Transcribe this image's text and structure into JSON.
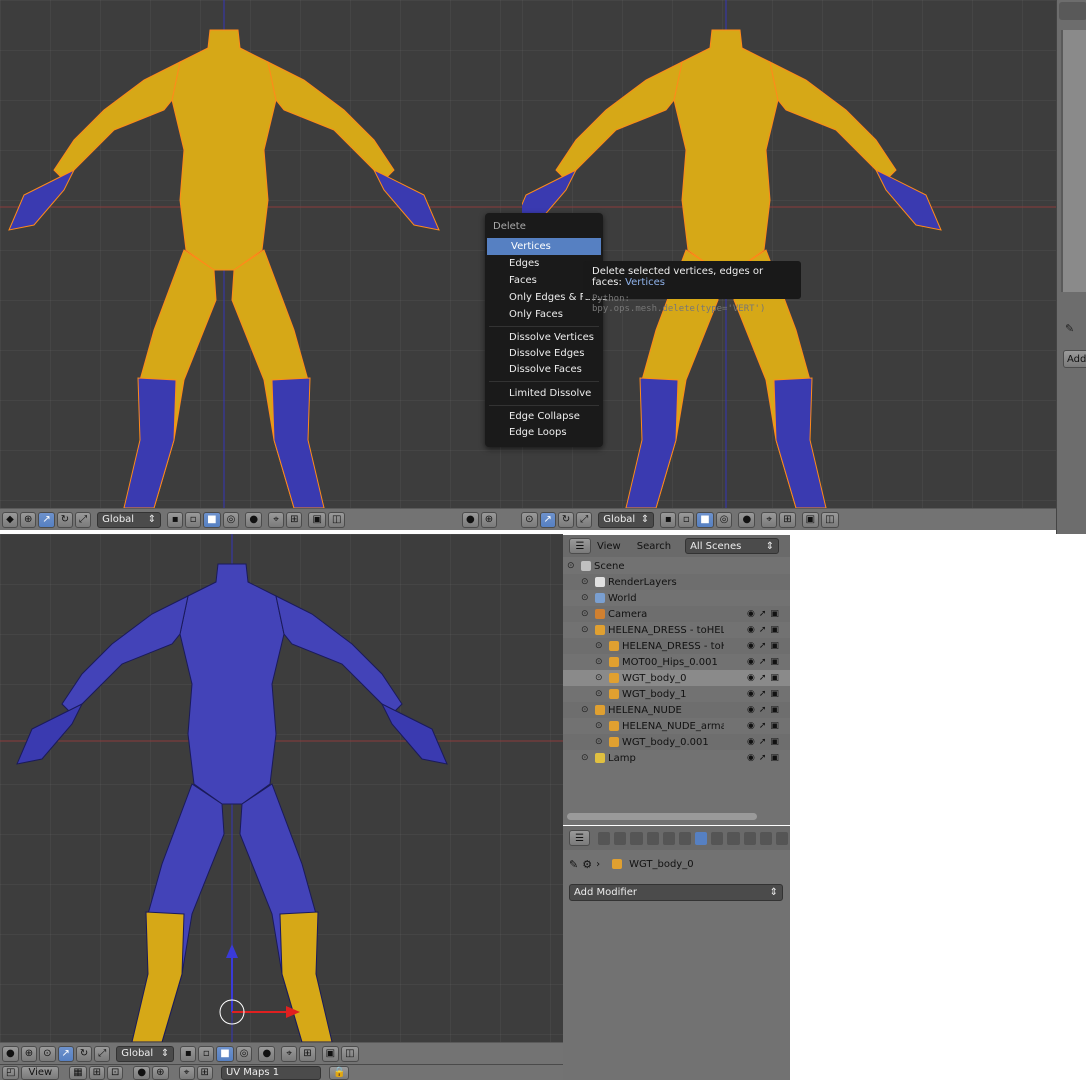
{
  "viewport_top_left": {
    "header": {
      "transform_orientation": "Global"
    }
  },
  "viewport_top_right": {
    "header": {
      "transform_orientation": "Global"
    }
  },
  "viewport_bottom": {
    "header": {
      "transform_orientation": "Global"
    }
  },
  "delete_menu": {
    "title": "Delete",
    "items": [
      "Vertices",
      "Edges",
      "Faces",
      "Only Edges & Faces",
      "Only Faces",
      "Dissolve Vertices",
      "Dissolve Edges",
      "Dissolve Faces",
      "Limited Dissolve",
      "Edge Collapse",
      "Edge Loops"
    ],
    "active": "Vertices"
  },
  "tooltip": {
    "description": "Delete selected vertices, edges or faces:",
    "value": "Vertices",
    "python": "Python: bpy.ops.mesh.delete(type='VERT')"
  },
  "outliner": {
    "menu_view": "View",
    "menu_search": "Search",
    "display_mode": "All Scenes",
    "rows": [
      {
        "label": "Scene",
        "indent": 0,
        "icon": "scene-icon"
      },
      {
        "label": "RenderLayers",
        "indent": 1,
        "icon": "render-layers-icon"
      },
      {
        "label": "World",
        "indent": 1,
        "icon": "world-icon"
      },
      {
        "label": "Camera",
        "indent": 1,
        "icon": "camera-icon"
      },
      {
        "label": "HELENA_DRESS - toHELENA_DOA",
        "indent": 1,
        "icon": "armature-icon"
      },
      {
        "label": "HELENA_DRESS - toHELENA_",
        "indent": 2,
        "icon": "armature-data-icon"
      },
      {
        "label": "MOT00_Hips_0.001",
        "indent": 2,
        "icon": "mesh-icon"
      },
      {
        "label": "WGT_body_0",
        "indent": 2,
        "icon": "mesh-icon",
        "selected": true
      },
      {
        "label": "WGT_body_1",
        "indent": 2,
        "icon": "mesh-icon"
      },
      {
        "label": "HELENA_NUDE",
        "indent": 1,
        "icon": "armature-icon"
      },
      {
        "label": "HELENA_NUDE_armature",
        "indent": 2,
        "icon": "armature-data-icon"
      },
      {
        "label": "WGT_body_0.001",
        "indent": 2,
        "icon": "mesh-icon"
      },
      {
        "label": "Lamp",
        "indent": 1,
        "icon": "lamp-icon"
      }
    ]
  },
  "properties": {
    "object_name": "WGT_body_0",
    "add_modifier_label": "Add Modifier"
  },
  "right_panel": {
    "add_label": "Add"
  },
  "bottom_bar": {
    "view_label": "View",
    "uv_map": "UV Maps 1"
  },
  "colors": {
    "accent": "#5680c2",
    "mesh_yellow": "#e8b400",
    "mesh_blue": "#3a3ab0",
    "wire_orange": "#ff8a1a"
  }
}
